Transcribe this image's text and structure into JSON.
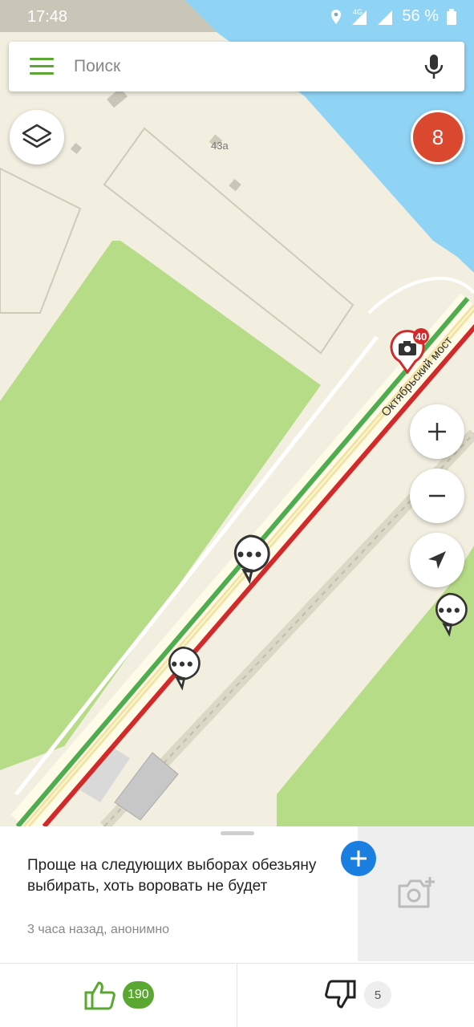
{
  "status_bar": {
    "time": "17:48",
    "network": "4G",
    "battery": "56 %"
  },
  "search": {
    "placeholder": "Поиск"
  },
  "map": {
    "building_number": "43а",
    "street_label": "Октябрьский мост",
    "speed_camera_limit": "40",
    "icons": [
      "speed-camera-icon",
      "chat-bubble-icon"
    ],
    "colors": {
      "road_green": "#4fad4f",
      "road_red": "#d22a2a",
      "water": "#8fd3f5",
      "park": "#b7dc88",
      "land": "#f2efe1"
    }
  },
  "badge": {
    "count": "8"
  },
  "comment": {
    "text": "Проще на следующих выборах обезьяну выбирать, хоть воровать не будет",
    "meta": "3 часа назад, анонимно"
  },
  "votes": {
    "likes": "190",
    "dislikes": "5"
  }
}
